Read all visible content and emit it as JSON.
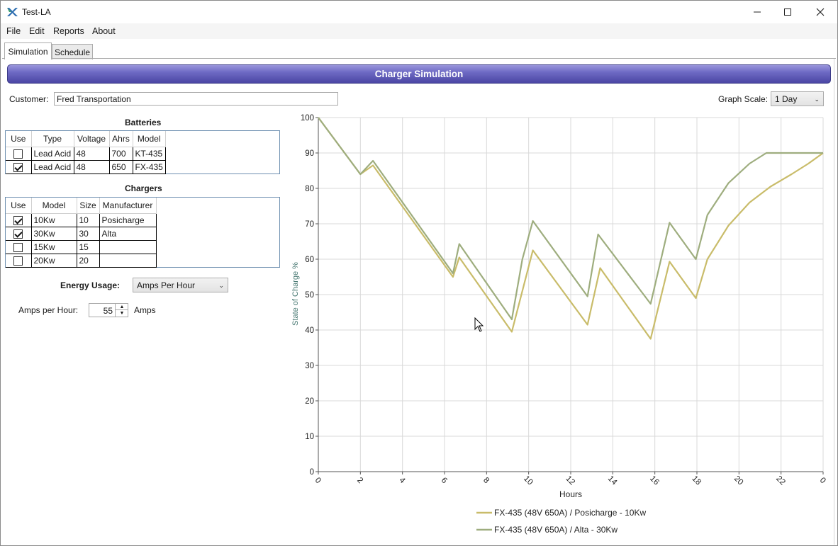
{
  "window": {
    "title": "Test-LA"
  },
  "menu": [
    "File",
    "Edit",
    "Reports",
    "About"
  ],
  "tabs": [
    "Simulation",
    "Schedule"
  ],
  "header": {
    "title": "Charger Simulation"
  },
  "customer": {
    "label": "Customer:",
    "value": "Fred Transportation"
  },
  "graph_scale": {
    "label": "Graph Scale:",
    "value": "1 Day"
  },
  "batteries": {
    "title": "Batteries",
    "columns": [
      "Use",
      "Type",
      "Voltage",
      "Ahrs",
      "Model"
    ],
    "rows": [
      {
        "use": false,
        "type": "Lead Acid",
        "voltage": "48",
        "ahrs": "700",
        "model": "KT-435"
      },
      {
        "use": true,
        "type": "Lead Acid",
        "voltage": "48",
        "ahrs": "650",
        "model": "FX-435"
      }
    ]
  },
  "chargers": {
    "title": "Chargers",
    "columns": [
      "Use",
      "Model",
      "Size",
      "Manufacturer"
    ],
    "rows": [
      {
        "use": true,
        "model": "10Kw",
        "size": "10",
        "manufacturer": "Posicharge"
      },
      {
        "use": true,
        "model": "30Kw",
        "size": "30",
        "manufacturer": "Alta"
      },
      {
        "use": false,
        "model": "15Kw",
        "size": "15",
        "manufacturer": ""
      },
      {
        "use": false,
        "model": "20Kw",
        "size": "20",
        "manufacturer": ""
      }
    ]
  },
  "energy_usage": {
    "label": "Energy Usage:",
    "value": "Amps Per Hour"
  },
  "amps_per_hour": {
    "label": "Amps per Hour:",
    "value": "55",
    "unit": "Amps"
  },
  "colors": {
    "series1": "#c9bc6a",
    "series2": "#9ead7e",
    "accent": "#5f5ab8"
  },
  "chart_data": {
    "type": "line",
    "xlabel": "Hours",
    "ylabel": "State of Charge %",
    "ylim": [
      0,
      100
    ],
    "yticks": [
      "0",
      "10",
      "20",
      "30",
      "40",
      "50",
      "60",
      "70",
      "80",
      "90",
      "100"
    ],
    "xticks": [
      "0",
      "2",
      "4",
      "6",
      "8",
      "10",
      "12",
      "14",
      "16",
      "18",
      "20",
      "22",
      "0"
    ],
    "xlim": [
      0,
      24
    ],
    "grid": true,
    "legend": "bottom",
    "series": [
      {
        "name": "FX-435 (48V 650A) / Posicharge - 10Kw",
        "color": "#c9bc6a",
        "x": [
          0,
          2,
          2.6,
          6.4,
          6.7,
          9.2,
          10.2,
          12.8,
          13.4,
          15.8,
          16.7,
          17.95,
          18.5,
          19.5,
          20.5,
          21.5,
          22.5,
          23.3,
          24
        ],
        "y": [
          100,
          84,
          86.5,
          55,
          60.5,
          39.5,
          62.5,
          41.5,
          57.5,
          37.5,
          59.3,
          49,
          60,
          69.5,
          76,
          80.5,
          84,
          87,
          90
        ]
      },
      {
        "name": "FX-435 (48V 650A) / Alta - 30Kw",
        "color": "#9ead7e",
        "x": [
          0,
          2,
          2.6,
          6.4,
          6.7,
          9.2,
          9.7,
          10.2,
          12.8,
          13.3,
          15.8,
          16.7,
          17.95,
          18.5,
          19.5,
          20.5,
          21.3,
          24
        ],
        "y": [
          100,
          84,
          87.8,
          56,
          64.3,
          43,
          60,
          70.8,
          49.5,
          67,
          47.4,
          70.3,
          60,
          72.5,
          81.5,
          87,
          90,
          90
        ]
      }
    ]
  }
}
